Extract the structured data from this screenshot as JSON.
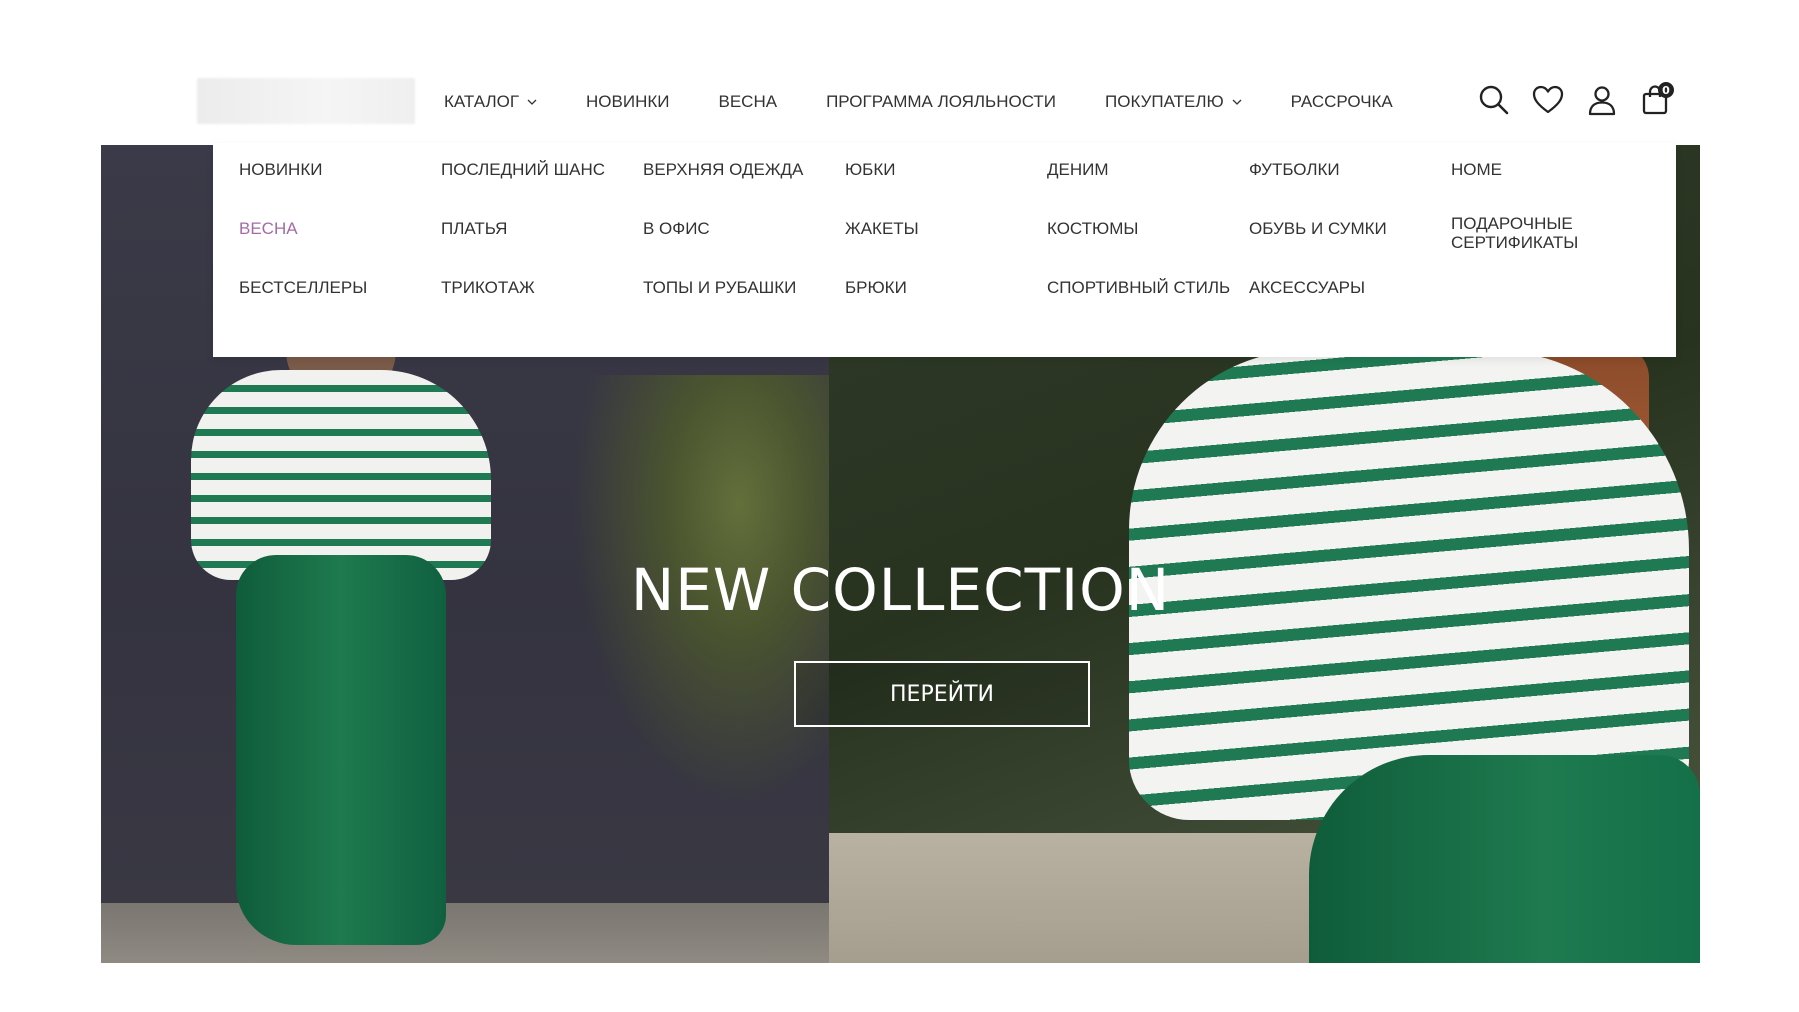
{
  "header": {
    "nav": [
      {
        "label": "КАТАЛОГ",
        "dropdown": true
      },
      {
        "label": "НОВИНКИ",
        "dropdown": false
      },
      {
        "label": "ВЕСНА",
        "dropdown": false
      },
      {
        "label": "ПРОГРАММА ЛОЯЛЬНОСТИ",
        "dropdown": false
      },
      {
        "label": "ПОКУПАТЕЛЮ",
        "dropdown": true
      },
      {
        "label": "РАССРОЧКА",
        "dropdown": false
      }
    ],
    "icons": [
      "search-icon",
      "heart-icon",
      "user-icon",
      "bag-icon"
    ],
    "cart_count": "0"
  },
  "dropdown": {
    "columns": [
      [
        "НОВИНКИ",
        "ВЕСНА",
        "БЕСТСЕЛЛЕРЫ"
      ],
      [
        "ПОСЛЕДНИЙ ШАНС",
        "ПЛАТЬЯ",
        "ТРИКОТАЖ"
      ],
      [
        "ВЕРХНЯЯ ОДЕЖДА",
        "В ОФИС",
        "ТОПЫ И РУБАШКИ"
      ],
      [
        "ЮБКИ",
        "ЖАКЕТЫ",
        "БРЮКИ"
      ],
      [
        "ДЕНИМ",
        "КОСТЮМЫ",
        "СПОРТИВНЫЙ СТИЛЬ"
      ],
      [
        "ФУТБОЛКИ",
        "ОБУВЬ И СУМКИ",
        "АКСЕССУАРЫ"
      ],
      [
        "HOME",
        "ПОДАРОЧНЫЕ СЕРТИФИКАТЫ"
      ]
    ],
    "highlighted_item": "ВЕСНА",
    "highlight_color": "#a46ba8"
  },
  "hero": {
    "title": "NEW COLLECTION",
    "button_label": "ПЕРЕЙТИ"
  }
}
